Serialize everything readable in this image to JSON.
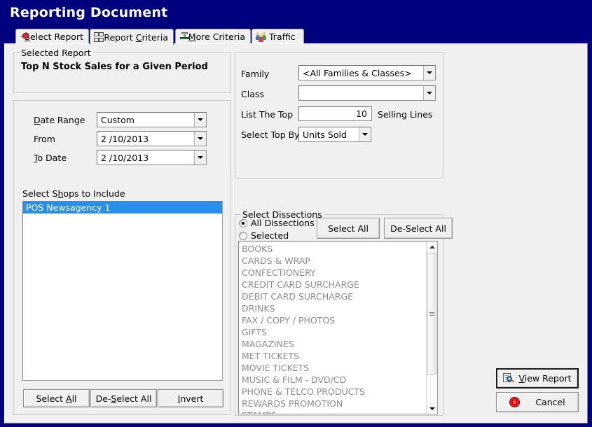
{
  "window": {
    "title": "Reporting Document",
    "header_color": "#00007e",
    "face_color": "#f0f0f0"
  },
  "tabs": [
    {
      "label": "Select Report",
      "accel": "S",
      "icon": "pushpin-icon",
      "active": false
    },
    {
      "label": "Report Criteria",
      "accel": "C",
      "icon": "hierarchy-icon",
      "active": true
    },
    {
      "label": "More Criteria",
      "accel": "M",
      "icon": "connector-icon",
      "active": false
    },
    {
      "label": "Traffic",
      "accel": "",
      "icon": "people-icon",
      "active": false
    }
  ],
  "selected_report": {
    "group_title": "Selected Report",
    "report_name": "Top N Stock Sales for a Given Period"
  },
  "date_criteria": {
    "date_range": {
      "label": "Date Range",
      "accel": "D",
      "value": "Custom"
    },
    "from": {
      "label": "From",
      "accel": "",
      "value": "2 /10/2013"
    },
    "to_date": {
      "label": "To Date",
      "accel": "T",
      "value": "2 /10/2013"
    }
  },
  "shops": {
    "label": "Select Shops to Include",
    "accel": "h",
    "items": [
      {
        "text": "POS Newsagency 1",
        "selected": true
      }
    ],
    "buttons": [
      {
        "label": "Select All",
        "accel": "A"
      },
      {
        "label": "De-Select All",
        "accel": "S"
      },
      {
        "label": "Invert",
        "accel": "I"
      }
    ]
  },
  "filters": {
    "family": {
      "label": "Family",
      "value": "<All Families & Classes>"
    },
    "class": {
      "label": "Class",
      "value": ""
    },
    "list_the_top": {
      "label": "List The Top",
      "value": "10",
      "suffix": "Selling Lines"
    },
    "select_top_by": {
      "label": "Select Top By",
      "value": "Units Sold"
    }
  },
  "dissections": {
    "group_title": "Select Dissections",
    "radios": [
      {
        "label": "All Dissections",
        "checked": true
      },
      {
        "label": "Selected",
        "checked": false
      }
    ],
    "buttons": [
      {
        "label": "Select All"
      },
      {
        "label": "De-Select All"
      }
    ],
    "items": [
      "BOOKS",
      "CARDS & WRAP",
      "CONFECTIONERY",
      "CREDIT CARD SURCHARGE",
      "DEBIT CARD SURCHARGE",
      "DRINKS",
      "FAX / COPY / PHOTOS",
      "GIFTS",
      "MAGAZINES",
      "MET TICKETS",
      "MOVIE TICKETS",
      "MUSIC & FILM - DVD/CD",
      "PHONE & TELCO PRODUCTS",
      "REWARDS PROMOTION",
      "STAMPS"
    ],
    "scrollbar": {
      "up": "scroll-up-arrow",
      "down": "scroll-down-arrow"
    }
  },
  "actions": {
    "view_report": {
      "label": "View Report",
      "accel": "V",
      "icon": "magnifier-page-icon",
      "default": true
    },
    "cancel": {
      "label": "Cancel",
      "accel": "",
      "icon": "stop-icon"
    }
  }
}
